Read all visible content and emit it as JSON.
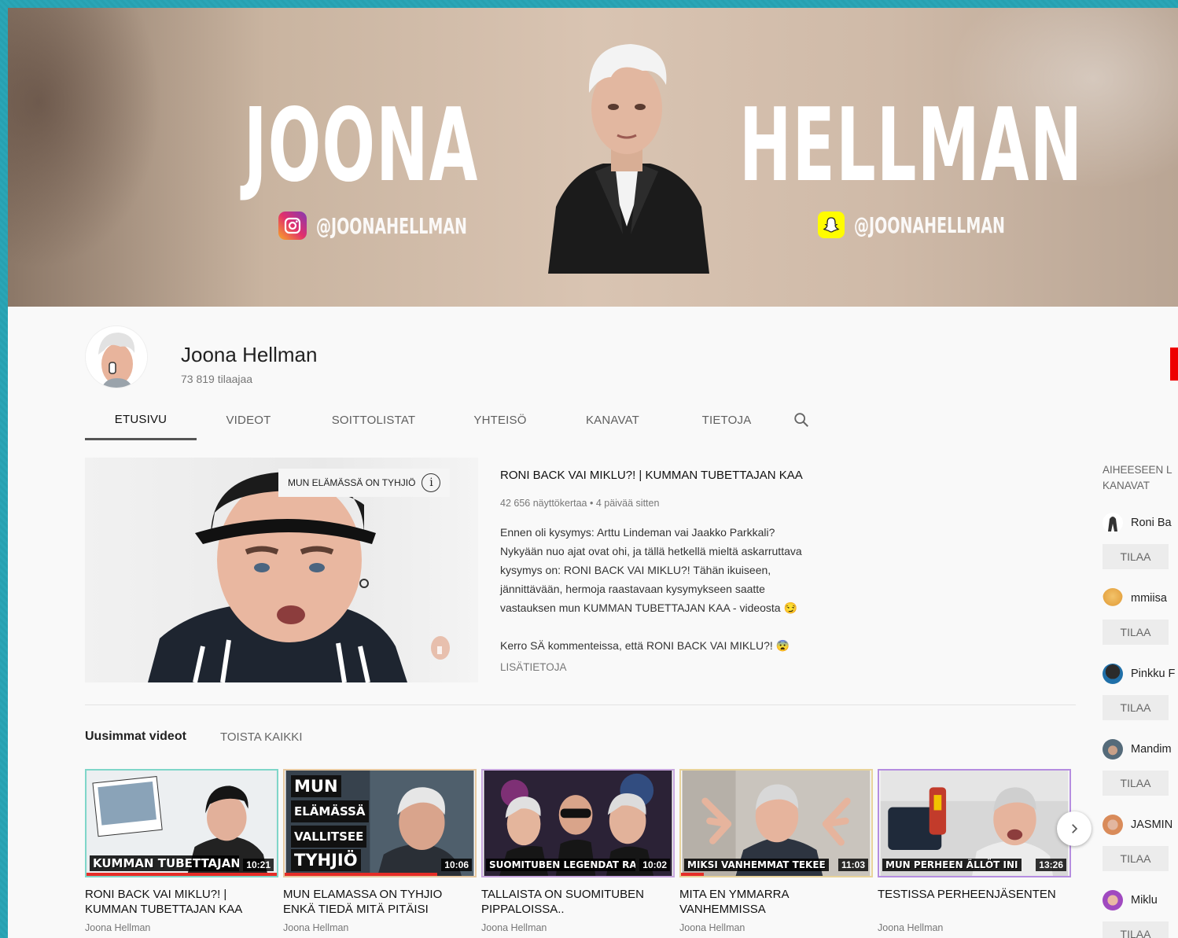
{
  "banner": {
    "first_word": "JOONA",
    "second_word": "HELLMAN",
    "instagram_handle": "@JOONAHELLMAN",
    "snapchat_handle": "@JOONAHELLMAN"
  },
  "channel": {
    "name": "Joona Hellman",
    "subscribers": "73 819 tilaajaa"
  },
  "tabs": [
    {
      "label": "ETUSIVU",
      "active": true
    },
    {
      "label": "VIDEOT"
    },
    {
      "label": "SOITTOLISTAT"
    },
    {
      "label": "YHTEISÖ"
    },
    {
      "label": "KANAVAT"
    },
    {
      "label": "TIETOJA"
    }
  ],
  "featured": {
    "chip_text": "MUN ELÄMÄSSÄ ON TYHJIÖ",
    "title": "RONI BACK VAI MIKLU?! | KUMMAN TUBETTAJAN KAA",
    "meta": "42 656 näyttökertaa • 4 päivää sitten",
    "description": [
      "Ennen oli kysymys: Arttu Lindeman vai Jaakko Parkkali?",
      "Nykyään nuo ajat ovat ohi, ja tällä hetkellä mieltä askarruttava",
      "kysymys on: RONI BACK VAI MIKLU?! Tähän ikuiseen,",
      "jännittävään, hermoja raastavaan kysymykseen saatte",
      "vastauksen mun KUMMAN TUBETTAJAN KAA - videosta 😏",
      "Kerro SÄ kommenteissa, että RONI BACK VAI MIKLU?! 😨"
    ],
    "more_label": "LISÄTIETOJA"
  },
  "shelf": {
    "title": "Uusimmat videot",
    "play_all": "TOISTA KAIKKI",
    "videos": [
      {
        "caption": "KUMMAN TUBETTAJAN",
        "duration": "10:21",
        "title": "RONI BACK VAI MIKLU?! | KUMMAN TUBETTAJAN KAA",
        "channel": "Joona Hellman",
        "border": "#7fd6c9",
        "watched": 1.0
      },
      {
        "caption_lines": [
          "MUN",
          "ELÄMÄSSÄ",
          "VALLITSEE",
          "TYHJIÖ"
        ],
        "duration": "10:06",
        "title": "MUN ELAMASSA ON TYHJIO ENKÄ TIEDÄ MITÄ PITÄISI",
        "channel": "Joona Hellman",
        "border": "#e6c8a0",
        "watched": 0.8
      },
      {
        "caption": "SUOMITUBEN LEGENDAT RA",
        "duration": "10:02",
        "title": "TALLAISTA ON SUOMITUBEN PIPPALOISSA..",
        "channel": "Joona Hellman",
        "border": "#c7a6dd",
        "watched": 0
      },
      {
        "caption": "MIKSI VANHEMMAT TEKEE",
        "duration": "11:03",
        "title": "MITA EN YMMARRA VANHEMMISSA",
        "channel": "Joona Hellman",
        "border": "#e8d39a",
        "watched": 0.12
      },
      {
        "caption": "MUN PERHEEN ÄLLÖT INI",
        "duration": "13:26",
        "title": "TESTISSA PERHEENJÄSENTEN",
        "channel": "Joona Hellman",
        "border": "#b58de0",
        "watched": 0
      }
    ]
  },
  "related": {
    "heading_line1": "AIHEESEEN L",
    "heading_line2": "KANAVAT",
    "subscribe_label": "TILAA",
    "channels": [
      {
        "name": "Roni Ba",
        "color": "#333333"
      },
      {
        "name": "mmiisa",
        "color": "#e6a645"
      },
      {
        "name": "Pinkku F",
        "color": "#1f6fa8"
      },
      {
        "name": "Mandim",
        "color": "#556b7a"
      },
      {
        "name": "JASMIN",
        "color": "#d98b5a"
      },
      {
        "name": "Miklu",
        "color": "#a04ac0"
      }
    ]
  },
  "colors": {
    "accent_red": "#e52d27",
    "page_bg": "#f9f9f9",
    "frame_teal": "#2aa6b7"
  }
}
